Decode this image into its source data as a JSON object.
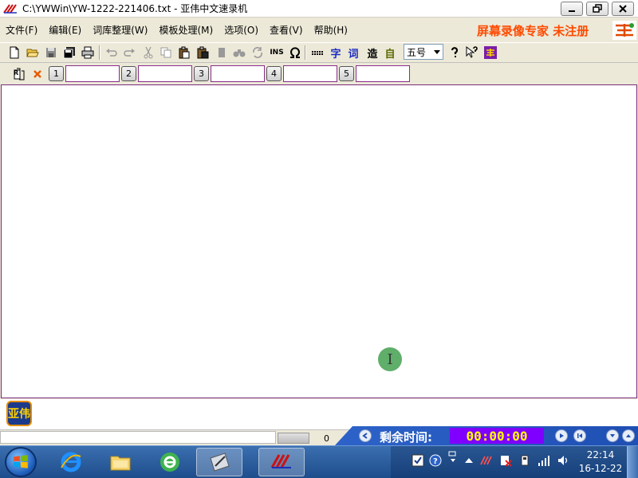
{
  "window": {
    "title": "C:\\YWWin\\YW-1222-221406.txt - 亚伟中文速录机"
  },
  "menu": {
    "items": [
      "文件(F)",
      "编辑(E)",
      "词库整理(W)",
      "模板处理(M)",
      "选项(O)",
      "查看(V)",
      "帮助(H)"
    ],
    "promo": "屏幕录像专家  未注册"
  },
  "toolbar": {
    "ins_label": "INS",
    "zi_label": "字",
    "ci_label": "词",
    "zao_label": "造",
    "zi2_label": "自",
    "font_size": "五号"
  },
  "slots": {
    "labels": [
      "1",
      "2",
      "3",
      "4",
      "5"
    ]
  },
  "logo": {
    "text": "亚伟"
  },
  "status": {
    "count": "0",
    "timer_label": "剩余时间:",
    "timer_value": "00:00:00"
  },
  "taskbar": {
    "time": "22:14",
    "date": "16-12-22"
  },
  "colors": {
    "promo": "#ff4a00",
    "timer_bg": "#8000ff",
    "timer_fg": "#ffff00",
    "editor_border": "#7a2a7a"
  }
}
